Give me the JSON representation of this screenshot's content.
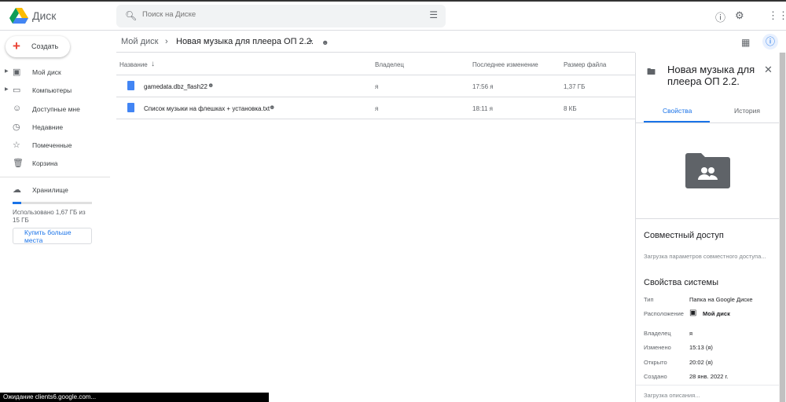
{
  "app": {
    "name": "Диск"
  },
  "search": {
    "placeholder": "Поиск на Диске"
  },
  "sidebar": {
    "create_label": "Создать",
    "items": [
      {
        "label": "Мой диск",
        "icon": "my-drive-icon"
      },
      {
        "label": "Компьютеры",
        "icon": "computers-icon"
      },
      {
        "label": "Доступные мне",
        "icon": "shared-icon"
      },
      {
        "label": "Недавние",
        "icon": "clock-icon"
      },
      {
        "label": "Помеченные",
        "icon": "star-icon"
      },
      {
        "label": "Корзина",
        "icon": "trash-icon"
      }
    ],
    "storage_label": "Хранилище",
    "storage_used": "Использовано 1,67 ГБ из 15 ГБ",
    "storage_fraction": 0.11,
    "buy_label": "Купить больше места"
  },
  "breadcrumb": {
    "root": "Мой диск",
    "current": "Новая музыка для плеера ОП 2.2."
  },
  "table": {
    "headers": {
      "name": "Название",
      "owner": "Владелец",
      "modified": "Последнее изменение",
      "size": "Размер файла"
    },
    "rows": [
      {
        "name": "gamedata.dbz_flash22",
        "owner": "я",
        "modified": "17:56 я",
        "size": "1,37 ГБ"
      },
      {
        "name": "Список музыки на флешках + установка.txt",
        "owner": "я",
        "modified": "18:11 я",
        "size": "8 КБ"
      }
    ]
  },
  "panel": {
    "title": "Новая музыка для плеера ОП 2.2.",
    "tabs": [
      "Свойства",
      "История"
    ],
    "sharing_title": "Совместный доступ",
    "sharing_loading": "Загрузка параметров совместного доступа...",
    "system_title": "Свойства системы",
    "props": [
      {
        "k": "Тип",
        "v": "Папка на Google Диске"
      },
      {
        "k": "Расположение",
        "v": "Мой диск"
      },
      {
        "k": "Владелец",
        "v": "я"
      },
      {
        "k": "Изменено",
        "v": "15:13 (я)"
      },
      {
        "k": "Открыто",
        "v": "20:02 (я)"
      },
      {
        "k": "Создано",
        "v": "28 янв. 2022 г."
      }
    ],
    "description_loading": "Загрузка описания..."
  },
  "status_bar": "Ожидание clients6.google.com...",
  "colors": {
    "accent": "#1a73e8"
  }
}
